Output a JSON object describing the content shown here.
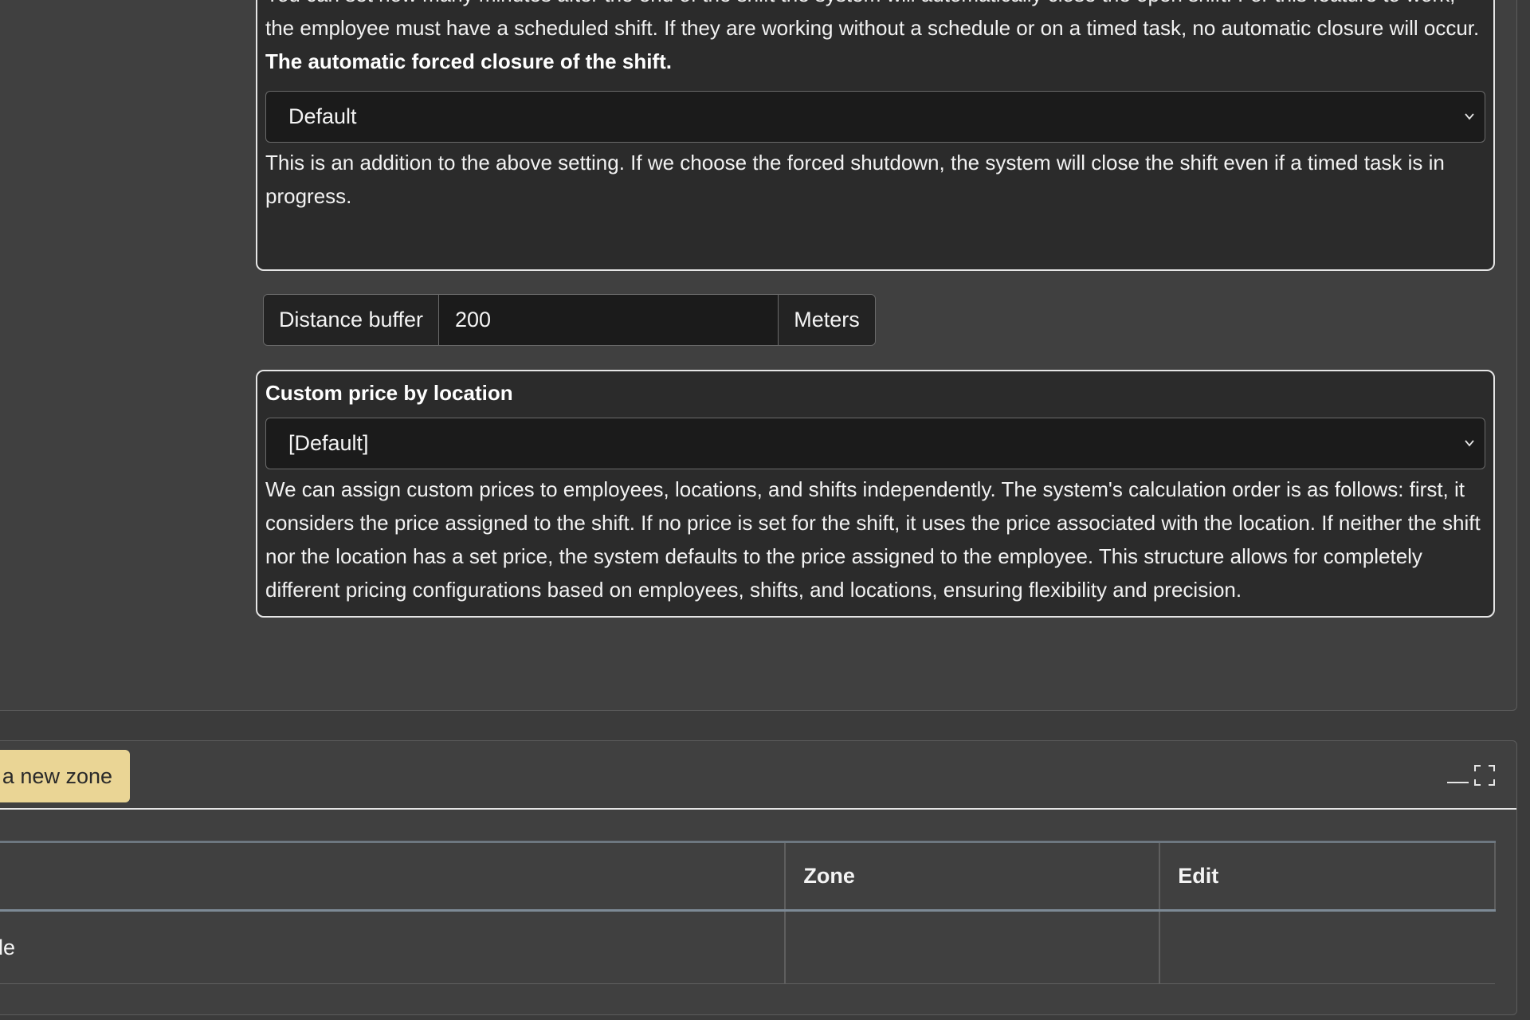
{
  "shift_settings": {
    "intro_text": "You can set how many minutes after the end of the shift the system will automatically close the open shift. For this feature to work, the employee must have a scheduled shift. If they are working without a schedule or on a timed task, no automatic closure will occur.",
    "forced_closure_heading": "The automatic forced closure of the shift.",
    "forced_closure_selected": "Default",
    "forced_closure_help": "This is an addition to the above setting. If we choose the forced shutdown, the system will close the shift even if a timed task is in progress."
  },
  "distance_buffer": {
    "label": "Distance buffer",
    "value": "200",
    "unit": "Meters"
  },
  "custom_price": {
    "heading": "Custom price by location",
    "selected": "[Default]",
    "help": "We can assign custom prices to employees, locations, and shifts independently. The system's calculation order is as follows: first, it considers the price assigned to the shift. If no price is set for the shift, it uses the price associated with the location. If neither the shift nor the location has a set price, the system defaults to the price assigned to the employee. This structure allows for completely different pricing configurations based on employees, shifts, and locations, ensuring flexibility and precision."
  },
  "zones": {
    "add_button_label": "l a new zone",
    "minimize_icon": "minimize-icon",
    "expand_icon": "expand-icon",
    "table": {
      "columns": [
        "",
        "Zone",
        "Edit"
      ],
      "rows": [
        [
          "able",
          "",
          ""
        ]
      ]
    }
  }
}
